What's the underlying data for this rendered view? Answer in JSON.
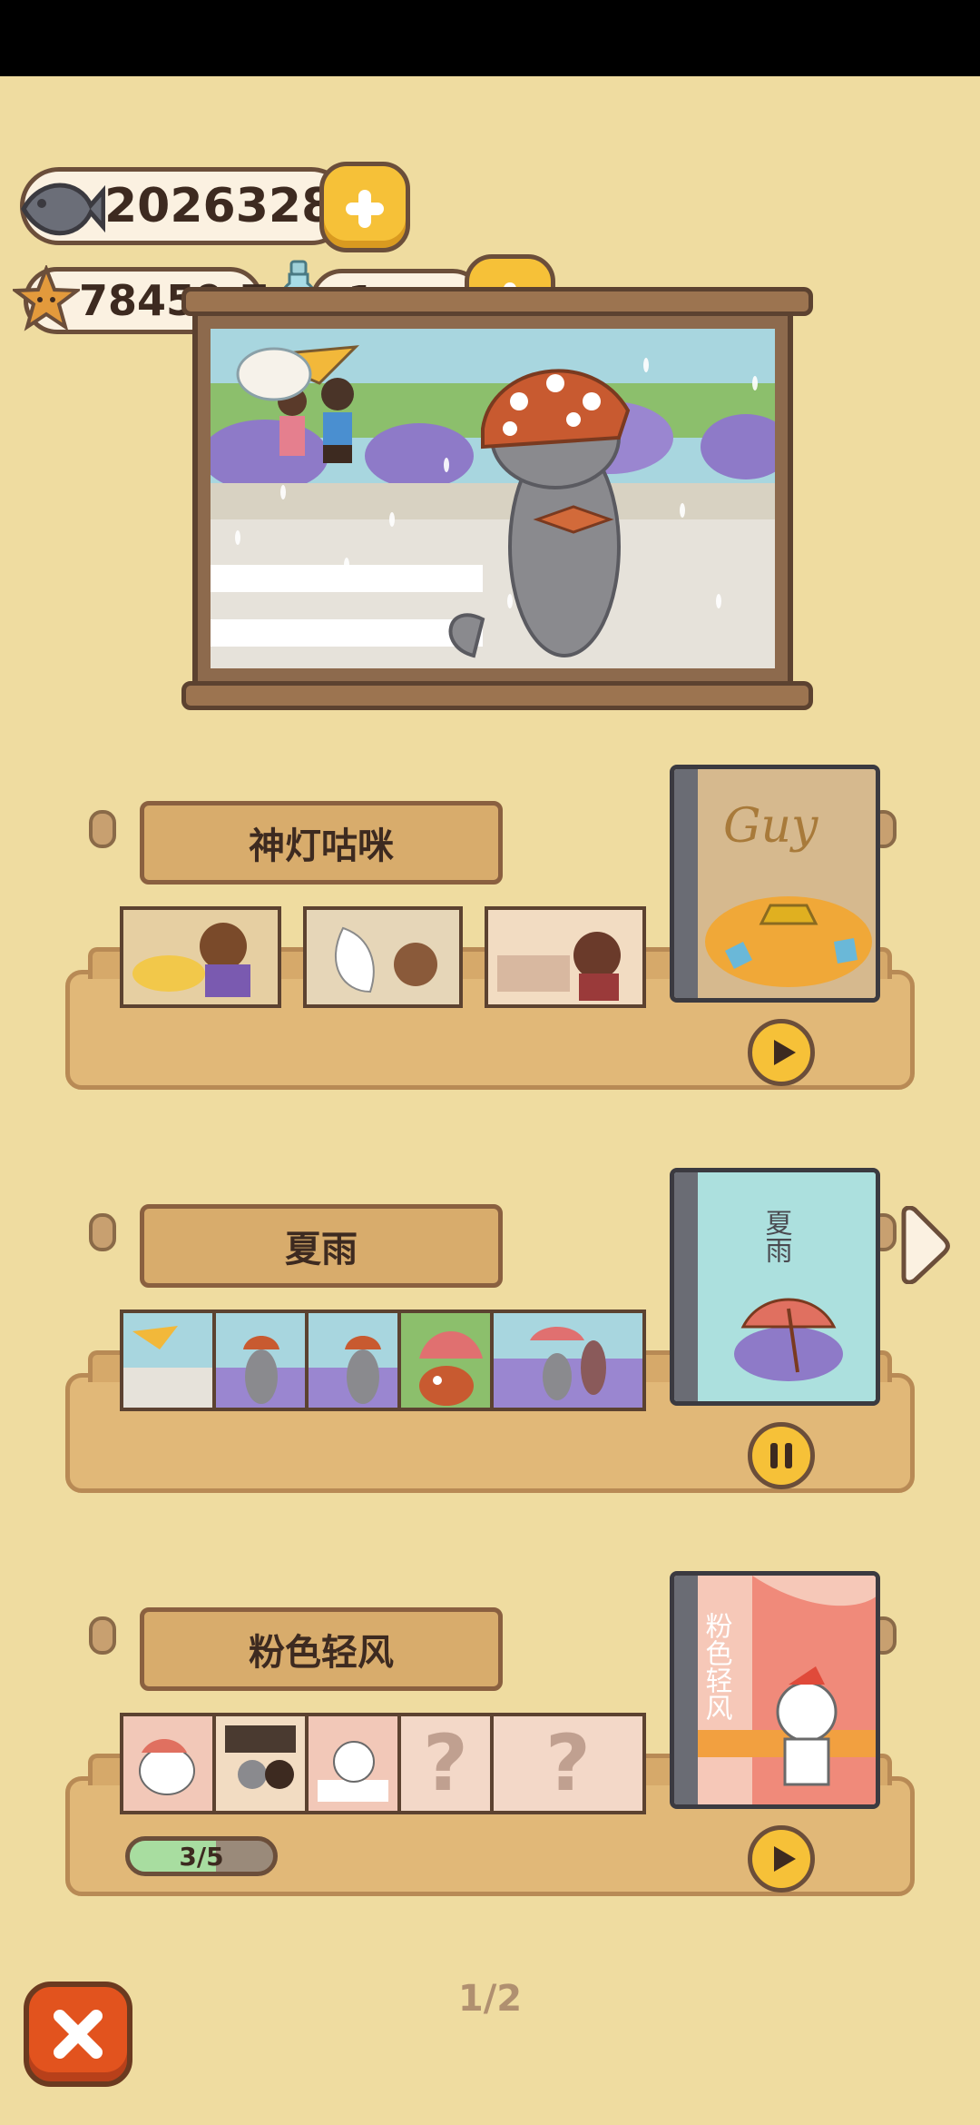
{
  "currencies": {
    "fish": {
      "value": "2026328",
      "icon": "fish-icon"
    },
    "star": {
      "value": "78459.7",
      "icon": "star-icon"
    },
    "bottle": {
      "value": "1",
      "icon": "bottle-icon"
    }
  },
  "albums": [
    {
      "title": "神灯咕咪",
      "cover_title": "Guy",
      "state": "play",
      "thumbs": 3
    },
    {
      "title": "夏雨",
      "cover_title": "夏雨",
      "state": "pause",
      "thumbs": 5
    },
    {
      "title": "粉色轻风",
      "cover_title": "粉色轻风",
      "state": "play",
      "unlocked": 3,
      "total": 5,
      "progress_label": "3/5",
      "locked_marks": [
        "?",
        "?"
      ]
    }
  ],
  "pagination": {
    "label": "1/2"
  },
  "colors": {
    "background": "#efdca0",
    "accent": "#f6c138",
    "close": "#e2531e"
  }
}
